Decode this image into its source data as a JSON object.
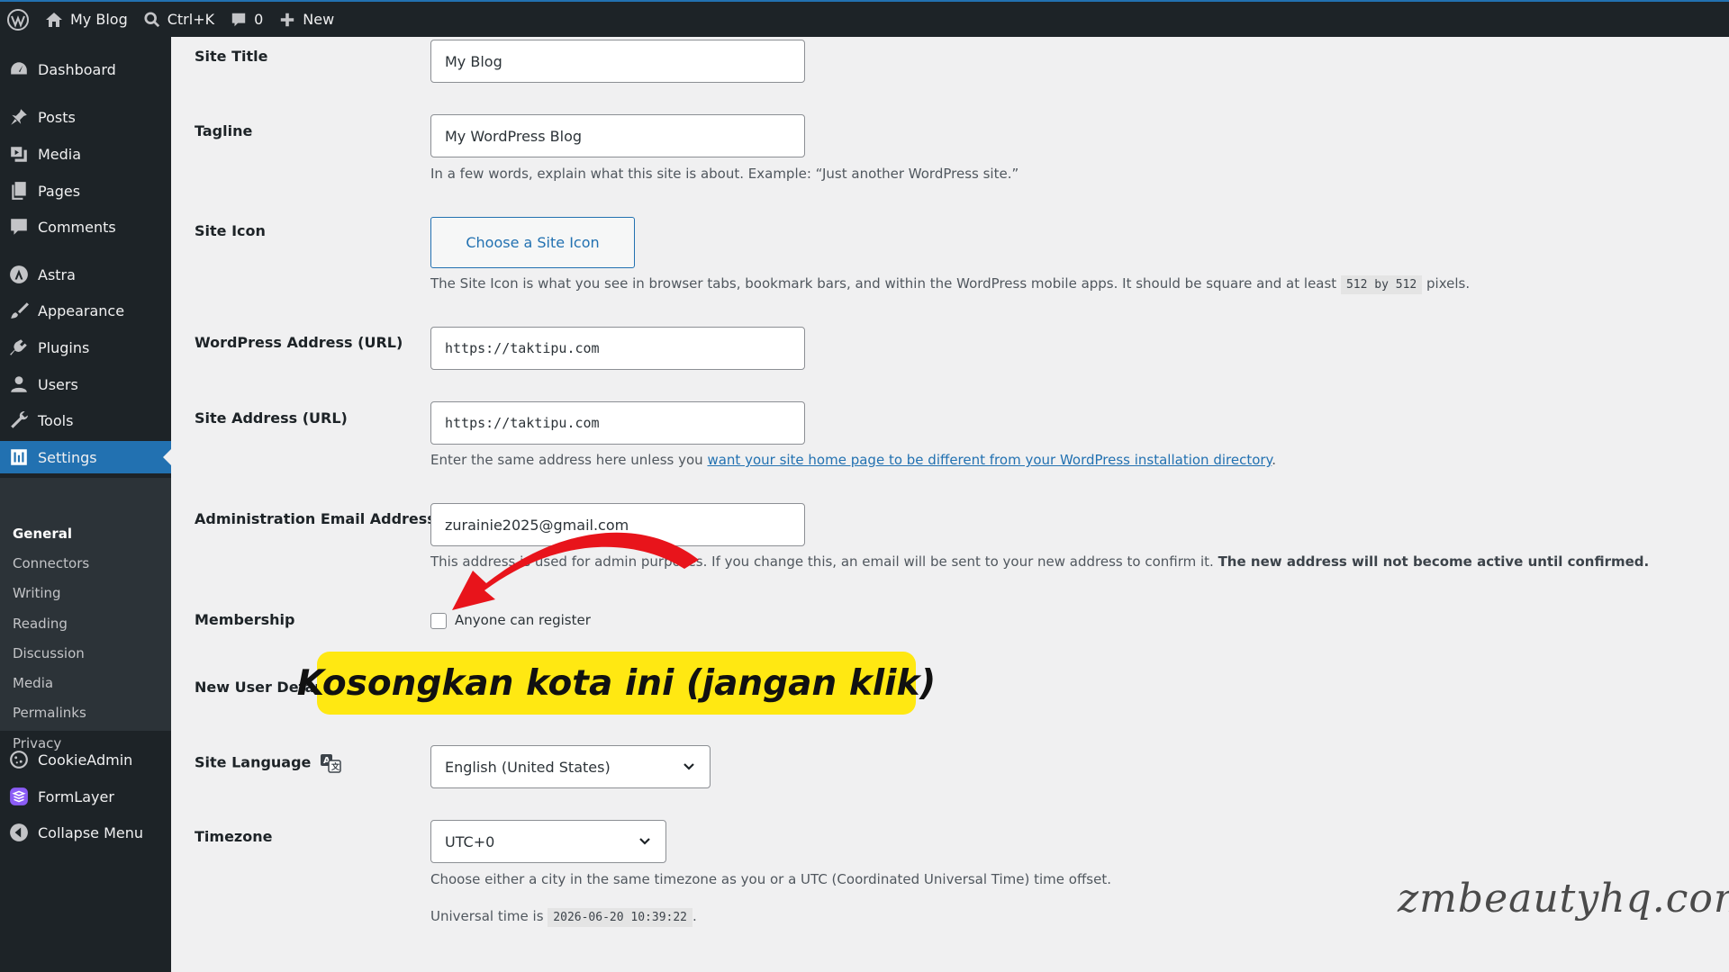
{
  "adminbar": {
    "site_name": "My Blog",
    "search_shortcut": "Ctrl+K",
    "comments_count": "0",
    "new_label": "New"
  },
  "sidebar": {
    "items": [
      {
        "label": "Dashboard",
        "icon": "dashboard-icon"
      },
      {
        "label": "Posts",
        "icon": "pin-icon"
      },
      {
        "label": "Media",
        "icon": "media-icon"
      },
      {
        "label": "Pages",
        "icon": "pages-icon"
      },
      {
        "label": "Comments",
        "icon": "comment-icon"
      },
      {
        "label": "Astra",
        "icon": "astra-icon"
      },
      {
        "label": "Appearance",
        "icon": "brush-icon"
      },
      {
        "label": "Plugins",
        "icon": "plug-icon"
      },
      {
        "label": "Users",
        "icon": "user-icon"
      },
      {
        "label": "Tools",
        "icon": "wrench-icon"
      },
      {
        "label": "Settings",
        "icon": "settings-icon"
      },
      {
        "label": "CookieAdmin",
        "icon": "cookie-icon"
      },
      {
        "label": "FormLayer",
        "icon": "formlayer-icon"
      },
      {
        "label": "Collapse Menu",
        "icon": "collapse-icon"
      }
    ],
    "submenu": [
      "General",
      "Connectors",
      "Writing",
      "Reading",
      "Discussion",
      "Media",
      "Permalinks",
      "Privacy"
    ]
  },
  "form": {
    "site_title": {
      "label": "Site Title",
      "value": "My Blog"
    },
    "tagline": {
      "label": "Tagline",
      "value": "My WordPress Blog",
      "desc": "In a few words, explain what this site is about. Example: “Just another WordPress site.”"
    },
    "site_icon": {
      "label": "Site Icon",
      "button": "Choose a Site Icon",
      "desc_pre": "The Site Icon is what you see in browser tabs, bookmark bars, and within the WordPress mobile apps. It should be square and at least",
      "desc_code": "512 by 512",
      "desc_post": "pixels."
    },
    "wp_address": {
      "label": "WordPress Address (URL)",
      "value": "https://taktipu.com"
    },
    "site_address": {
      "label": "Site Address (URL)",
      "value": "https://taktipu.com",
      "desc_pre": "Enter the same address here unless you",
      "desc_link": "want your site home page to be different from your WordPress installation directory",
      "desc_post": "."
    },
    "admin_email": {
      "label": "Administration Email Address",
      "value": "zurainie2025@gmail.com",
      "desc_pre": "This address is used for admin purposes. If you change this, an email will be sent to your new address to confirm it.",
      "desc_bold": "The new address will not become active until confirmed."
    },
    "membership": {
      "label": "Membership",
      "checkbox_label": "Anyone can register",
      "checked": false
    },
    "new_user_role": {
      "label": "New User Default"
    },
    "site_language": {
      "label": "Site Language",
      "value": "English (United States)"
    },
    "timezone": {
      "label": "Timezone",
      "value": "UTC+0",
      "desc": "Choose either a city in the same timezone as you or a UTC (Coordinated Universal Time) time offset.",
      "universal_label": "Universal time is",
      "universal_value": "2026-06-20 10:39:22",
      "universal_post": "."
    }
  },
  "annotation": {
    "callout": "Kosongkan kota ini (jangan klik)",
    "arrow_color": "#e8141b",
    "callout_color": "#ffe812"
  },
  "watermark": "zmbeautyhq.com",
  "colors": {
    "accent": "#2271b1",
    "sidebar_bg": "#1d2327",
    "content_bg": "#f0f0f1"
  }
}
